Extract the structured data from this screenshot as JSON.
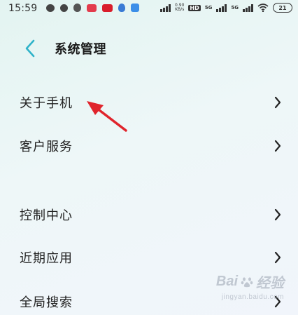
{
  "status_bar": {
    "time": "15:59",
    "net_speed_value": "0.90",
    "net_speed_unit": "KB/s",
    "hd_label": "HD",
    "fiveg_1": "5G",
    "fiveg_2": "5G",
    "battery": "21"
  },
  "header": {
    "title": "系统管理"
  },
  "menu": {
    "items": [
      {
        "label": "关于手机"
      },
      {
        "label": "客户服务"
      },
      {
        "label": "控制中心"
      },
      {
        "label": "近期应用"
      },
      {
        "label": "全局搜索"
      }
    ]
  },
  "watermark": {
    "brand": "Bai",
    "suffix": "经验",
    "url": "jingyan.baidu.com"
  },
  "colors": {
    "accent": "#2fb3c9",
    "annotation": "#e0242c"
  }
}
